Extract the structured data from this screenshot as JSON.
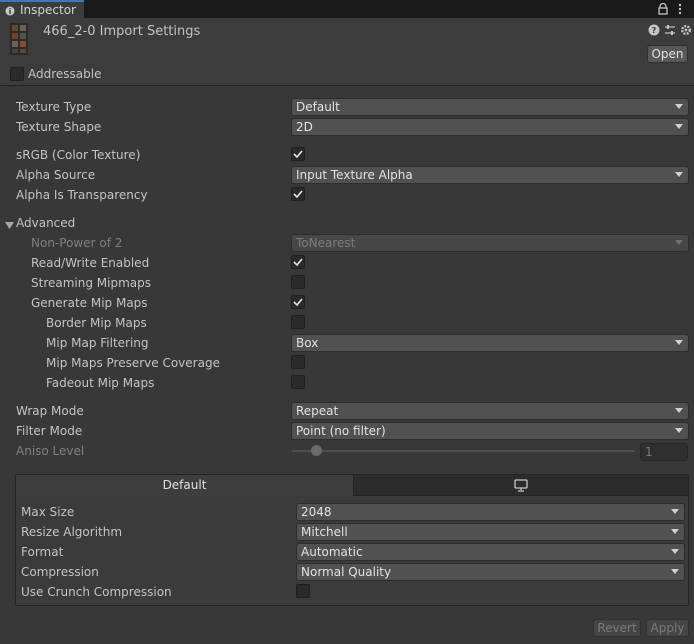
{
  "tab": {
    "label": "Inspector"
  },
  "header": {
    "title": "466_2-0 Import Settings",
    "open_label": "Open"
  },
  "addressable": {
    "label": "Addressable",
    "checked": false
  },
  "fields": {
    "texture_type": {
      "label": "Texture Type",
      "value": "Default"
    },
    "texture_shape": {
      "label": "Texture Shape",
      "value": "2D"
    },
    "srgb": {
      "label": "sRGB (Color Texture)",
      "checked": true
    },
    "alpha_source": {
      "label": "Alpha Source",
      "value": "Input Texture Alpha"
    },
    "alpha_is_transparency": {
      "label": "Alpha Is Transparency",
      "checked": true
    },
    "advanced": {
      "label": "Advanced"
    },
    "non_power_of_2": {
      "label": "Non-Power of 2",
      "value": "ToNearest"
    },
    "read_write": {
      "label": "Read/Write Enabled",
      "checked": true
    },
    "streaming_mipmaps": {
      "label": "Streaming Mipmaps",
      "checked": false
    },
    "generate_mip_maps": {
      "label": "Generate Mip Maps",
      "checked": true
    },
    "border_mip_maps": {
      "label": "Border Mip Maps",
      "checked": false
    },
    "mip_map_filtering": {
      "label": "Mip Map Filtering",
      "value": "Box"
    },
    "mip_maps_preserve_coverage": {
      "label": "Mip Maps Preserve Coverage",
      "checked": false
    },
    "fadeout_mip_maps": {
      "label": "Fadeout Mip Maps",
      "checked": false
    },
    "wrap_mode": {
      "label": "Wrap Mode",
      "value": "Repeat"
    },
    "filter_mode": {
      "label": "Filter Mode",
      "value": "Point (no filter)"
    },
    "aniso_level": {
      "label": "Aniso Level",
      "value": "1"
    }
  },
  "platform": {
    "default_tab": "Default",
    "max_size": {
      "label": "Max Size",
      "value": "2048"
    },
    "resize_algorithm": {
      "label": "Resize Algorithm",
      "value": "Mitchell"
    },
    "format": {
      "label": "Format",
      "value": "Automatic"
    },
    "compression": {
      "label": "Compression",
      "value": "Normal Quality"
    },
    "crunch": {
      "label": "Use Crunch Compression",
      "checked": false
    }
  },
  "footer": {
    "revert_label": "Revert",
    "apply_label": "Apply"
  },
  "icons": {
    "tab": "info-icon",
    "lock": "lock-icon",
    "menu": "kebab-icon",
    "help": "help-icon",
    "presets": "presets-icon",
    "settings": "gear-icon",
    "monitor": "monitor-icon"
  }
}
